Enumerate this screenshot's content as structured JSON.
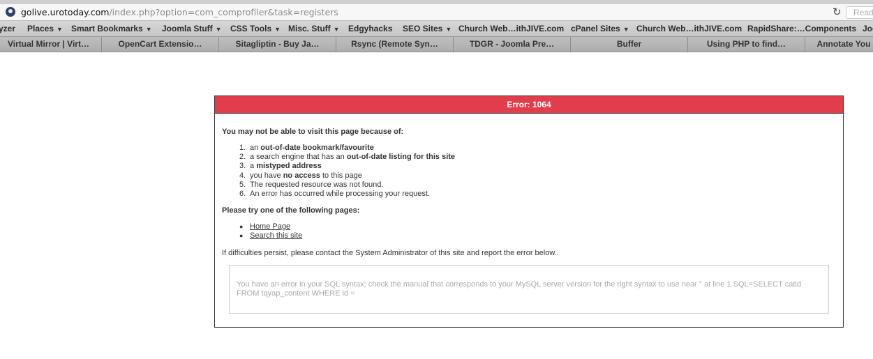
{
  "browser": {
    "url_host": "golive.urotoday.com",
    "url_path": "/index.php?option=com_comprofiler&task=registers",
    "reload_icon": "reload-icon",
    "reader_label": "Reader"
  },
  "bookmarks": [
    {
      "label": "yzer",
      "has_menu": false
    },
    {
      "label": "Places",
      "has_menu": true
    },
    {
      "label": "Smart Bookmarks",
      "has_menu": true
    },
    {
      "label": "Joomla Stuff",
      "has_menu": true
    },
    {
      "label": "CSS Tools",
      "has_menu": true
    },
    {
      "label": "Misc. Stuff",
      "has_menu": true
    },
    {
      "label": "Edgyhacks",
      "has_menu": false
    },
    {
      "label": "SEO Sites",
      "has_menu": true
    },
    {
      "label": "Church Web…ithJIVE.com",
      "has_menu": false
    },
    {
      "label": "cPanel Sites",
      "has_menu": true
    },
    {
      "label": "Church Web…ithJIVE.com",
      "has_menu": false
    },
    {
      "label": "RapidShare:…Components",
      "has_menu": false
    },
    {
      "label": "Joo",
      "has_menu": false
    }
  ],
  "tabs": [
    {
      "label": "Virtual Mirror | Virt…"
    },
    {
      "label": "OpenCart Extensio…"
    },
    {
      "label": "Sitagliptin - Buy Ja…"
    },
    {
      "label": "Rsync (Remote Syn…"
    },
    {
      "label": "TDGR - Joomla Pre…"
    },
    {
      "label": "Buffer"
    },
    {
      "label": "Using PHP to find…"
    },
    {
      "label": "Annotate You"
    }
  ],
  "error": {
    "title": "Error: 1064",
    "intro": "You may not be able to visit this page because of:",
    "reasons": [
      {
        "num": "1.",
        "pre": "an ",
        "bold": "out-of-date bookmark/favourite",
        "post": ""
      },
      {
        "num": "2.",
        "pre": "a search engine that has an ",
        "bold": "out-of-date listing for this site",
        "post": ""
      },
      {
        "num": "3.",
        "pre": "a ",
        "bold": "mistyped address",
        "post": ""
      },
      {
        "num": "4.",
        "pre": "you have ",
        "bold": "no access",
        "post": " to this page"
      },
      {
        "num": "5.",
        "pre": "The requested resource was not found.",
        "bold": "",
        "post": ""
      },
      {
        "num": "6.",
        "pre": "An error has occurred while processing your request.",
        "bold": "",
        "post": ""
      }
    ],
    "try_heading": "Please try one of the following pages:",
    "pages": [
      {
        "label": "Home Page"
      },
      {
        "label": "Search this site"
      }
    ],
    "persist_text": "If difficulties persist, please contact the System Administrator of this site and report the error below..",
    "sql_message": "You have an error in your SQL syntax; check the manual that corresponds to your MySQL server version for the right syntax to use near '' at line 1 SQL=SELECT catid FROM tqyap_content WHERE id ="
  }
}
